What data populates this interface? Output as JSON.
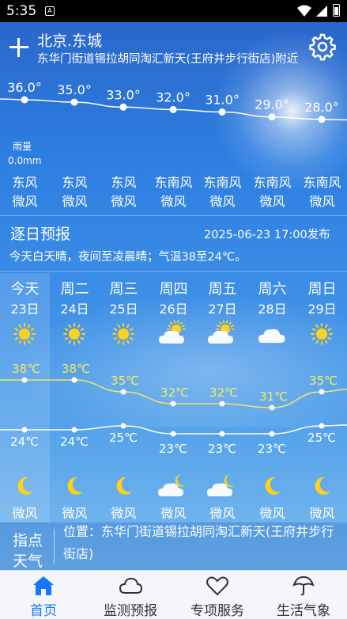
{
  "status_bar": {
    "time": "5:35",
    "app_badge": "A"
  },
  "header": {
    "city": "北京.东城",
    "address": "东华门街道锡拉胡同淘汇新天(王府井步行街店)附近"
  },
  "hourly": {
    "temps": [
      "36.0°",
      "35.0°",
      "33.0°",
      "32.0°",
      "31.0°",
      "29.0°",
      "28.0°"
    ],
    "rain_label": "雨量",
    "rain_value": "0.0mm",
    "wind_dirs": [
      "东风",
      "东风",
      "东风",
      "东南风",
      "东南风",
      "东南风",
      "东南风"
    ],
    "wind_levels": [
      "微风",
      "微风",
      "微风",
      "微风",
      "微风",
      "微风",
      "微风"
    ]
  },
  "forecast": {
    "title": "逐日预报",
    "publish_time": "2025-06-23 17:00发布",
    "summary": "今天白天晴，夜间至凌晨晴；气温38至24℃。",
    "days": [
      {
        "name": "今天",
        "date": "23日",
        "day_icon": "sun-icon",
        "high": "38℃",
        "low": "24℃",
        "night_icon": "moon-icon",
        "wind": "微风"
      },
      {
        "name": "周二",
        "date": "24日",
        "day_icon": "sun-icon",
        "high": "38℃",
        "low": "24℃",
        "night_icon": "moon-icon",
        "wind": "微风"
      },
      {
        "name": "周三",
        "date": "25日",
        "day_icon": "sun-icon",
        "high": "35℃",
        "low": "25℃",
        "night_icon": "moon-icon",
        "wind": "微风"
      },
      {
        "name": "周四",
        "date": "26日",
        "day_icon": "partly-cloudy-icon",
        "high": "32℃",
        "low": "23℃",
        "night_icon": "cloudy-night-icon",
        "wind": "微风"
      },
      {
        "name": "周五",
        "date": "27日",
        "day_icon": "partly-cloudy-icon",
        "high": "32℃",
        "low": "23℃",
        "night_icon": "cloudy-night-icon",
        "wind": "微风"
      },
      {
        "name": "周六",
        "date": "28日",
        "day_icon": "cloud-icon",
        "high": "31℃",
        "low": "23℃",
        "night_icon": "moon-icon",
        "wind": "微风"
      },
      {
        "name": "周日",
        "date": "29日",
        "day_icon": "sun-icon",
        "high": "35℃",
        "low": "25℃",
        "night_icon": "moon-icon",
        "wind": "微风"
      }
    ]
  },
  "tip": {
    "title": "指点天气",
    "location": "位置：东华门街道锡拉胡同淘汇新天(王府井步行街店)"
  },
  "nav": {
    "items": [
      {
        "label": "首页",
        "icon": "home-icon",
        "active": true
      },
      {
        "label": "监测预报",
        "icon": "cloud-outline-icon",
        "active": false
      },
      {
        "label": "专项服务",
        "icon": "heart-outline-icon",
        "active": false
      },
      {
        "label": "生活气象",
        "icon": "umbrella-outline-icon",
        "active": false
      }
    ]
  },
  "chart_data": [
    {
      "type": "line",
      "categories": [
        "1",
        "2",
        "3",
        "4",
        "5",
        "6",
        "7"
      ],
      "series": [
        {
          "values": [
            36.0,
            35.0,
            33.0,
            32.0,
            31.0,
            29.0,
            28.0
          ]
        }
      ]
    },
    {
      "type": "line",
      "categories": [
        "23日",
        "24日",
        "25日",
        "26日",
        "27日",
        "28日",
        "29日"
      ],
      "series": [
        {
          "values": [
            38,
            38,
            35,
            32,
            32,
            31,
            35
          ]
        },
        {
          "values": [
            24,
            24,
            25,
            23,
            23,
            23,
            25
          ]
        }
      ]
    }
  ],
  "colors": {
    "accent": "#1677ff",
    "high_line": "#f2e860",
    "sun": "#ffd21a"
  }
}
